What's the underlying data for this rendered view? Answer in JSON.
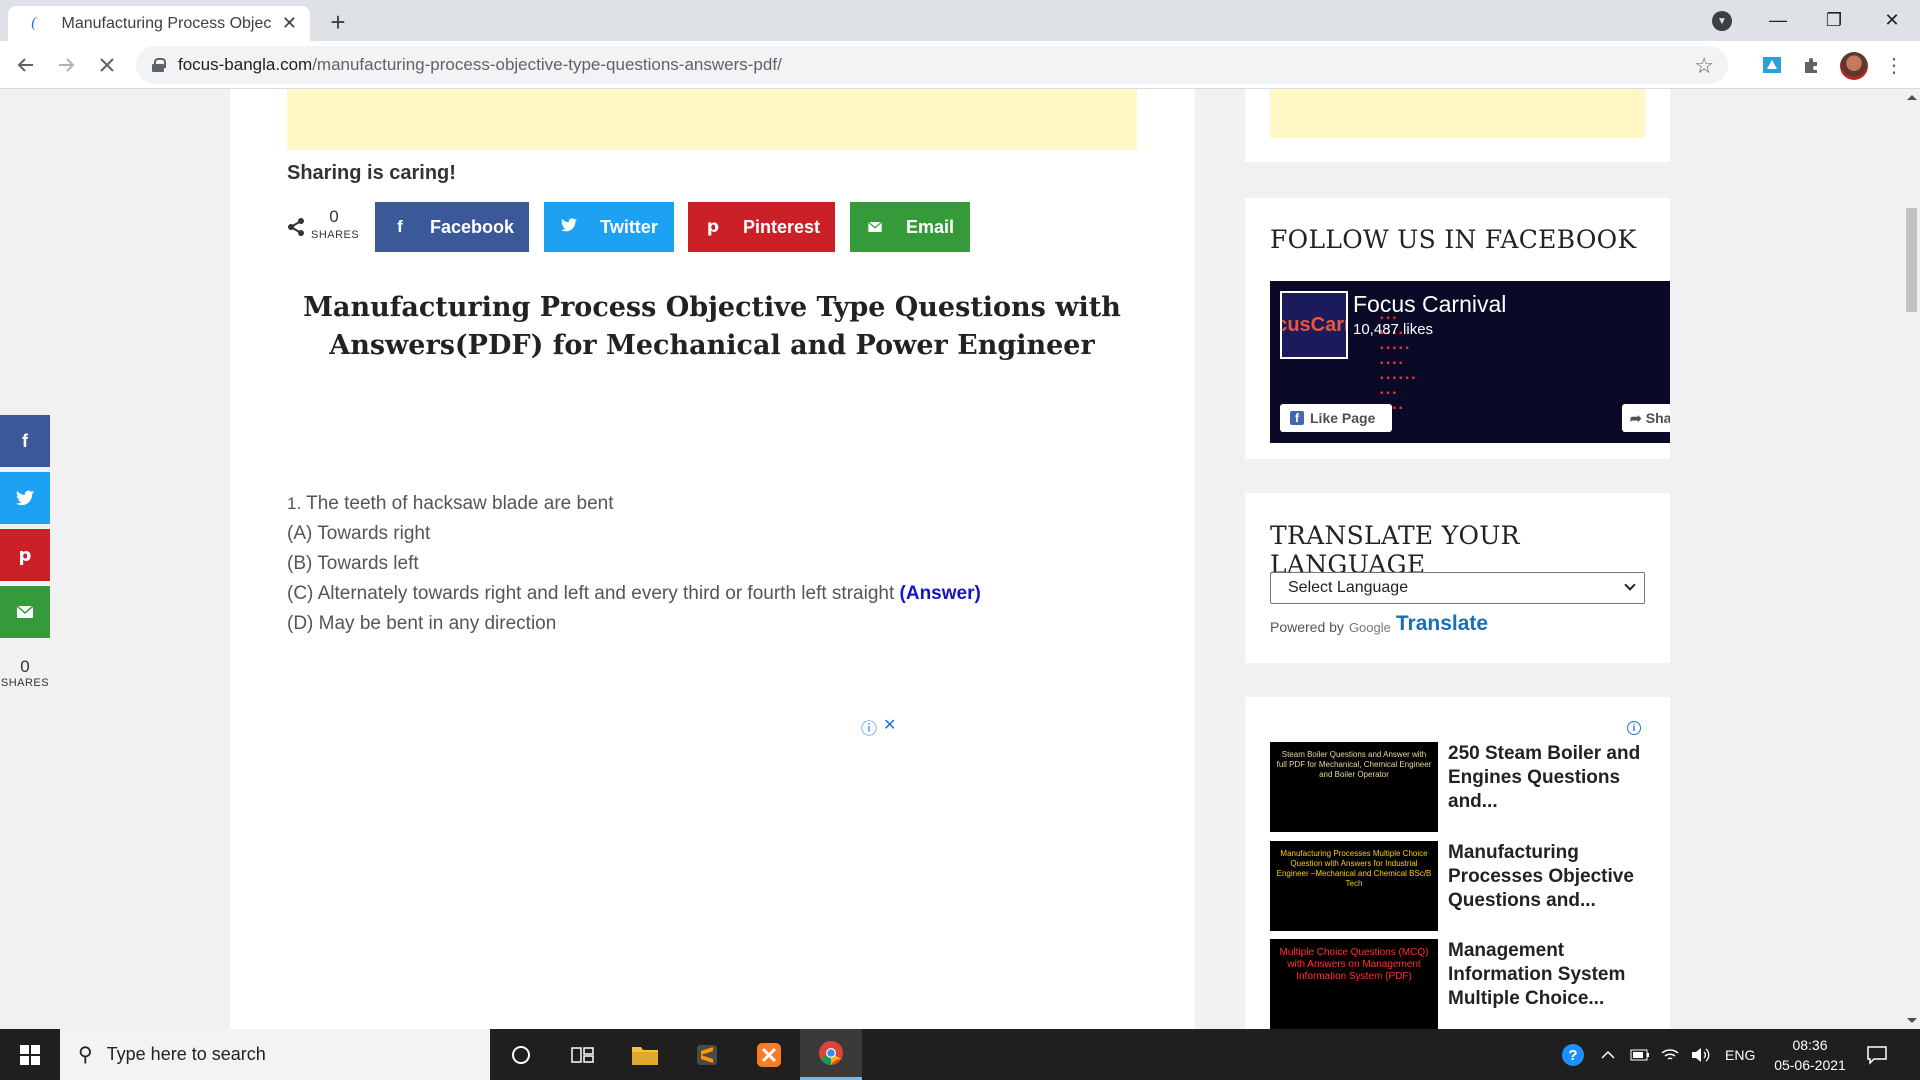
{
  "browser": {
    "tab_title": "Manufacturing Process Objective",
    "tab_favicon": "(",
    "new_tab_symbol": "+",
    "url_host": "focus-bangla.com",
    "url_path": "/manufacturing-process-objective-type-questions-answers-pdf/"
  },
  "share": {
    "heading": "Sharing is caring!",
    "count": "0",
    "count_label": "SHARES",
    "buttons": [
      {
        "label": "Facebook",
        "color": "#3b5998",
        "icon": "f"
      },
      {
        "label": "Twitter",
        "color": "#1da1f2",
        "icon": "twitter-bird"
      },
      {
        "label": "Pinterest",
        "color": "#cb2027",
        "icon": "p"
      },
      {
        "label": "Email",
        "color": "#359a39",
        "icon": "envelope"
      }
    ]
  },
  "article": {
    "title": "Manufacturing Process Objective Type Questions with Answers(PDF) for Mechanical and Power Engineer",
    "question": {
      "number": "1.",
      "text": "The teeth of hacksaw blade are bent",
      "options": [
        "(A) Towards right",
        "(B) Towards left",
        "(C) Alternately towards right and left and every third or fourth left straight",
        "(D) May be bent in any direction"
      ],
      "answer_label": "(Answer)"
    }
  },
  "float_share": {
    "count": "0",
    "label": "SHARES"
  },
  "sidebar": {
    "facebook_widget": {
      "title": "FOLLOW US IN FACEBOOK",
      "page_name": "Focus Carnival",
      "likes": "10,487 likes",
      "thumb_text": "cusCarr",
      "like_button": "Like Page",
      "share_button": "Sha"
    },
    "translate_widget": {
      "title": "TRANSLATE YOUR LANGUAGE",
      "select_value": "Select Language",
      "powered_by": "Powered by",
      "google": "Google",
      "translate": "Translate"
    },
    "related": [
      {
        "title": "250 Steam Boiler and Engines Questions and...",
        "thumb": "Steam Boiler Questions and Answer with full PDF for Mechanical, Chemical Engineer and Boiler Operator"
      },
      {
        "title": "Manufacturing Processes Objective Questions and...",
        "thumb": "Manufacturing Processes Multiple Choice Question with Answers for Industrial Engineer –Mechanical and Chemical BSc/B Tech"
      },
      {
        "title": "Management Information System Multiple Choice...",
        "thumb": "Multiple Choice Questions (MCQ) with Answers on Management Information System (PDF)"
      }
    ]
  },
  "taskbar": {
    "search_placeholder": "Type here to search",
    "language": "ENG",
    "time": "08:36",
    "date": "05-06-2021"
  }
}
